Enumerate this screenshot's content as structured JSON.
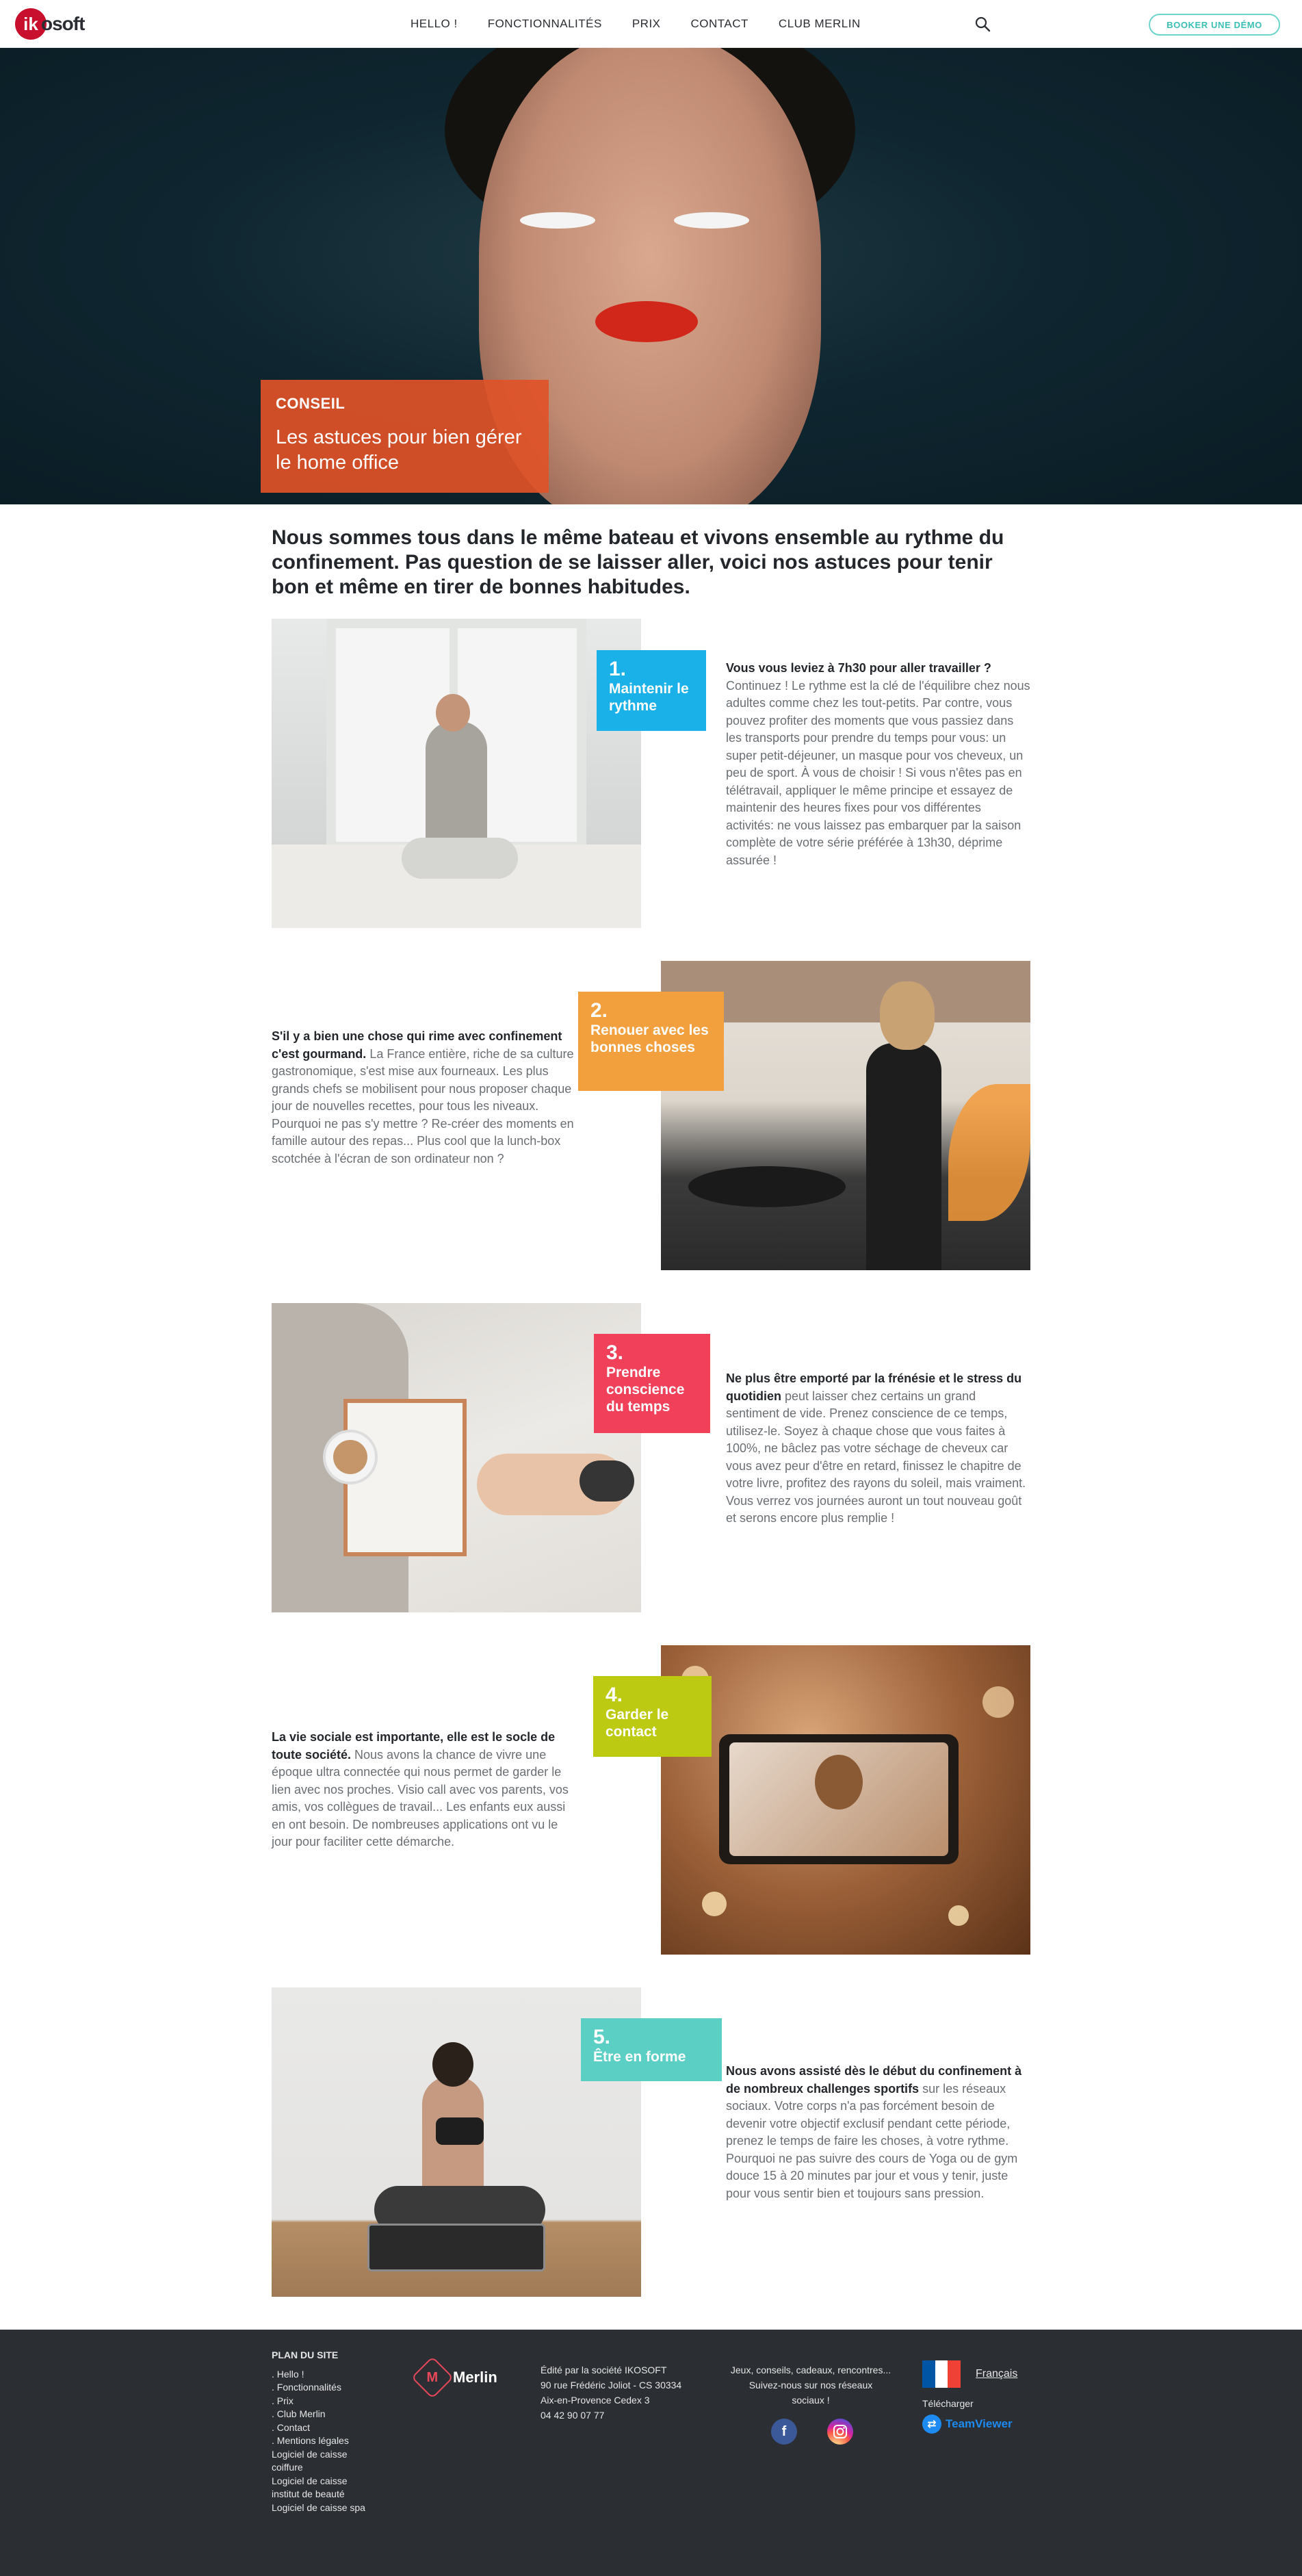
{
  "header": {
    "logo_mark": "ik",
    "logo_text": "osoft",
    "nav": [
      "HELLO !",
      "FONCTIONNALITÉS",
      "PRIX",
      "CONTACT",
      "CLUB MERLIN"
    ],
    "demo_button": "BOOKER UNE DÉMO"
  },
  "hero": {
    "tag": "CONSEIL",
    "title": "Les astuces pour bien gérer le home office"
  },
  "intro": "Nous sommes tous dans le même bateau et vivons ensemble au rythme du confinement. Pas question de se laisser aller, voici nos astuces pour tenir bon et même en tirer de bonnes habitudes.",
  "sections": [
    {
      "num": "1.",
      "title": "Maintenir le rythme",
      "color": "#1ab0e8",
      "lead": "Vous vous leviez à 7h30 pour aller travailler ?",
      "body": " Continuez ! Le rythme est la clé de l'équilibre chez nous adultes comme chez les tout-petits. Par contre, vous pouvez profiter des moments que vous passiez dans les transports pour prendre du temps pour vous: un super petit-déjeuner, un masque pour vos cheveux, un peu de sport. À vous de choisir ! Si vous n'êtes pas en télétravail, appliquer le même principe et essayez de maintenir des heures fixes pour vos différentes activités: ne vous laissez pas embarquer par la saison complète de votre série préférée à 13h30, déprime assurée !"
    },
    {
      "num": "2.",
      "title": "Renouer avec les bonnes choses",
      "color": "#f2a03d",
      "lead": "S'il y a bien une chose qui rime avec confinement c'est gourmand.",
      "body": " La France entière, riche de sa culture gastronomique, s'est mise aux fourneaux. Les plus grands chefs se mobilisent pour nous proposer chaque jour de nouvelles recettes, pour tous les niveaux. Pourquoi ne pas s'y mettre ? Re-créer des moments en famille autour des repas... Plus cool que la lunch-box scotchée à l'écran de son ordinateur non ?"
    },
    {
      "num": "3.",
      "title": "Prendre conscience du temps",
      "color": "#f0405a",
      "lead": "Ne plus être emporté par la frénésie et le stress du quotidien",
      "body": " peut laisser chez certains un grand sentiment de vide. Prenez conscience de ce temps, utilisez-le. Soyez à chaque chose que vous faites à 100%, ne bâclez pas votre séchage de cheveux car vous avez peur d'être en retard, finissez le chapitre de votre livre, profitez des rayons du soleil, mais vraiment. Vous verrez vos journées auront un tout nouveau goût et serons encore plus remplie !"
    },
    {
      "num": "4.",
      "title": "Garder le contact",
      "color": "#bccb12",
      "lead": "La vie sociale est importante, elle est le socle de toute société.",
      "body": " Nous avons la chance de vivre une époque ultra connectée qui nous permet de garder le lien avec nos proches. Visio call avec vos parents, vos amis, vos collègues de travail... Les enfants eux aussi en ont besoin. De nombreuses applications ont vu le jour pour faciliter cette démarche."
    },
    {
      "num": "5.",
      "title": "Être en forme",
      "color": "#5ccfc4",
      "lead": "Nous avons assisté dès le début du confinement à de nombreux challenges sportifs",
      "body": " sur les réseaux sociaux. Votre corps n'a pas forcément besoin de devenir votre objectif exclusif pendant cette période, prenez le temps de faire les choses, à votre rythme. Pourquoi ne pas suivre des cours de Yoga ou de gym douce 15 à 20 minutes par jour et vous y tenir, juste pour vous sentir bien et toujours sans pression."
    }
  ],
  "footer": {
    "sitemap_title": "PLAN DU SITE",
    "sitemap": [
      ". Hello !",
      ". Fonctionnalités",
      ". Prix",
      ". Club Merlin",
      ". Contact",
      ". Mentions légales",
      "Logiciel de caisse coiffure",
      "Logiciel de caisse institut de beauté",
      "Logiciel de caisse spa"
    ],
    "merlin": "Merlin",
    "address": [
      "Édité par la société IKOSOFT",
      "90 rue Frédéric Joliot - CS 30334",
      "Aix-en-Provence Cedex 3",
      "04 42 90 07 77"
    ],
    "social_text": [
      "Jeux, conseils, cadeaux, rencontres...",
      "Suivez-nous sur nos réseaux",
      "sociaux !"
    ],
    "language": "Français",
    "download": "Télécharger",
    "teamviewer": "TeamViewer"
  }
}
